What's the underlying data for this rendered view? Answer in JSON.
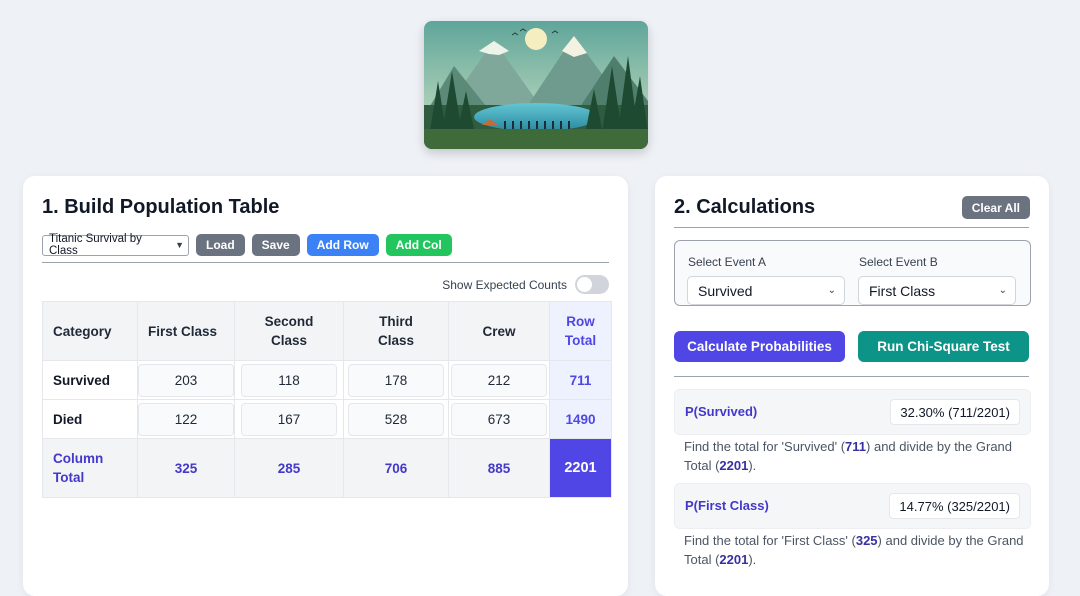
{
  "population_table": {
    "title": "1. Build Population Table",
    "preset": "Titanic Survival by Class",
    "buttons": {
      "load": "Load",
      "save": "Save",
      "add_row": "Add Row",
      "add_col": "Add Col"
    },
    "show_expected_label": "Show Expected Counts",
    "show_expected_on": false,
    "headers": [
      "Category",
      "First Class",
      "Second Class",
      "Third Class",
      "Crew",
      "Row Total"
    ],
    "rows": [
      {
        "label": "Survived",
        "values": [
          "203",
          "118",
          "178",
          "212"
        ],
        "total": "711"
      },
      {
        "label": "Died",
        "values": [
          "122",
          "167",
          "528",
          "673"
        ],
        "total": "1490"
      }
    ],
    "column_total": {
      "label": "Column Total",
      "values": [
        "325",
        "285",
        "706",
        "885"
      ],
      "grand": "2201"
    }
  },
  "calculations": {
    "title": "2. Calculations",
    "clear_all": "Clear All",
    "event_a_label": "Select Event A",
    "event_a_value": "Survived",
    "event_b_label": "Select Event B",
    "event_b_value": "First Class",
    "calc_button": "Calculate Probabilities",
    "chi_button": "Run Chi-Square Test",
    "results": [
      {
        "name": "P(Survived)",
        "value": "32.30% (711/2201)",
        "explain_pre": "Find the total for 'Survived' (",
        "explain_num": "711",
        "explain_mid": ") and divide by the Grand Total (",
        "explain_den": "2201",
        "explain_post": ")."
      },
      {
        "name": "P(First Class)",
        "value": "14.77% (325/2201)",
        "explain_pre": "Find the total for 'First Class' (",
        "explain_num": "325",
        "explain_mid": ") and divide by the Grand Total (",
        "explain_den": "2201",
        "explain_post": ")."
      }
    ]
  },
  "colors": {
    "accent": "#4f46e5",
    "teal": "#0d9488",
    "blue": "#3b82f6",
    "green": "#22c55e",
    "gray": "#6b7280"
  },
  "hero_image": "mountain-lake-landscape"
}
